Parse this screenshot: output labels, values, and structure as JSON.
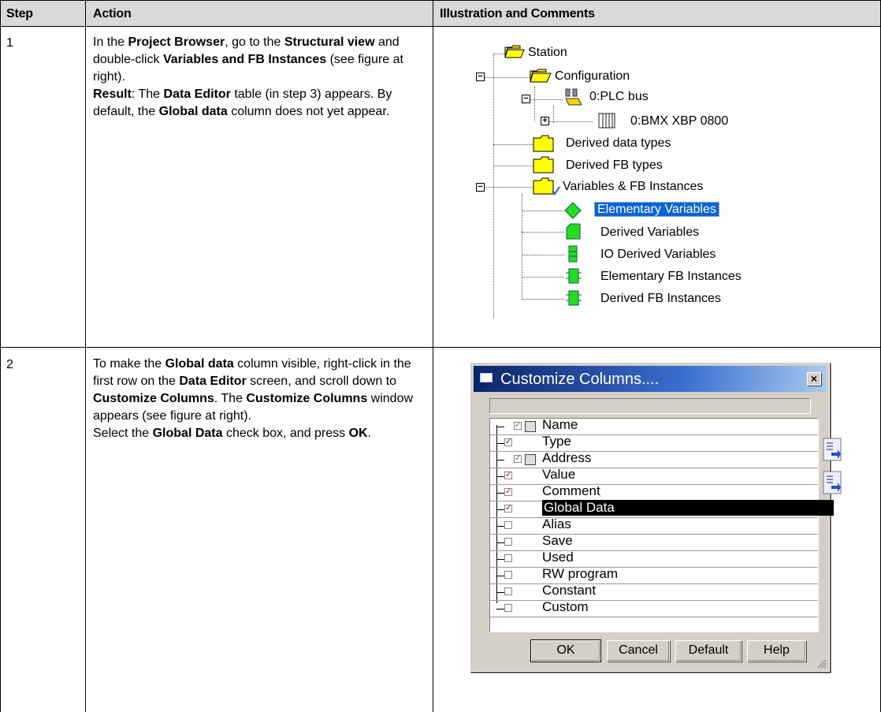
{
  "header": {
    "step": "Step",
    "action": "Action",
    "illustration": "Illustration and Comments"
  },
  "rows": [
    {
      "step": "1",
      "action": [
        {
          "t": "In the ",
          "b": false
        },
        {
          "t": "Project Browser",
          "b": true
        },
        {
          "t": ", go to the ",
          "b": false
        },
        {
          "t": "Structural view",
          "b": true
        },
        {
          "t": " and double-click ",
          "b": false
        },
        {
          "t": "Variables and FB Instances",
          "b": true
        },
        {
          "t": " (see figure at right).",
          "b": false
        },
        {
          "br": true
        },
        {
          "t": "Result",
          "b": true
        },
        {
          "t": ": The ",
          "b": false
        },
        {
          "t": "Data Editor",
          "b": true
        },
        {
          "t": " table (in step 3) appears. By default, the ",
          "b": false
        },
        {
          "t": "Global data",
          "b": true
        },
        {
          "t": " column does not yet appear.",
          "b": false
        }
      ]
    },
    {
      "step": "2",
      "action": [
        {
          "t": "To make the ",
          "b": false
        },
        {
          "t": "Global data",
          "b": true
        },
        {
          "t": " column visible, right-click in the first row on the ",
          "b": false
        },
        {
          "t": "Data Editor",
          "b": true
        },
        {
          "t": " screen, and scroll down to ",
          "b": false
        },
        {
          "t": "Customize Columns",
          "b": true
        },
        {
          "t": ". The ",
          "b": false
        },
        {
          "t": "Customize Columns",
          "b": true
        },
        {
          "t": " window appears (see figure at right).",
          "b": false
        },
        {
          "br": true
        },
        {
          "t": "Select the ",
          "b": false
        },
        {
          "t": "Global Data",
          "b": true
        },
        {
          "t": " check box, and press ",
          "b": false
        },
        {
          "t": "OK",
          "b": true
        },
        {
          "t": ".",
          "b": false
        }
      ]
    }
  ],
  "tree": {
    "station": "Station",
    "configuration": "Configuration",
    "plc_bus": "0:PLC bus",
    "rack": "0:BMX XBP 0800",
    "derived_data_types": "Derived data types",
    "derived_fb_types": "Derived FB types",
    "variables": "Variables & FB Instances",
    "elementary_variables": "Elementary Variables",
    "derived_variables": "Derived Variables",
    "io_derived_variables": "IO Derived Variables",
    "elementary_fb_instances": "Elementary FB Instances",
    "derived_fb_instances": "Derived FB Instances"
  },
  "dialog": {
    "title": "Customize Columns....",
    "close": "×",
    "columns": [
      {
        "label": "Name",
        "checked": true,
        "locked": true
      },
      {
        "label": "Type",
        "checked": true,
        "locked": false
      },
      {
        "label": "Address",
        "checked": true,
        "locked": true
      },
      {
        "label": "Value",
        "checked": true,
        "locked": false
      },
      {
        "label": "Comment",
        "checked": true,
        "locked": false
      },
      {
        "label": "Global Data",
        "checked": true,
        "locked": false,
        "selected": true
      },
      {
        "label": "Alias",
        "checked": false,
        "locked": false
      },
      {
        "label": "Save",
        "checked": false,
        "locked": false
      },
      {
        "label": "Used",
        "checked": false,
        "locked": false
      },
      {
        "label": "RW program",
        "checked": false,
        "locked": false
      },
      {
        "label": "Constant",
        "checked": false,
        "locked": false
      },
      {
        "label": "Custom",
        "checked": false,
        "locked": false
      }
    ],
    "buttons": {
      "ok": "OK",
      "cancel": "Cancel",
      "default": "Default",
      "help": "Help"
    }
  }
}
